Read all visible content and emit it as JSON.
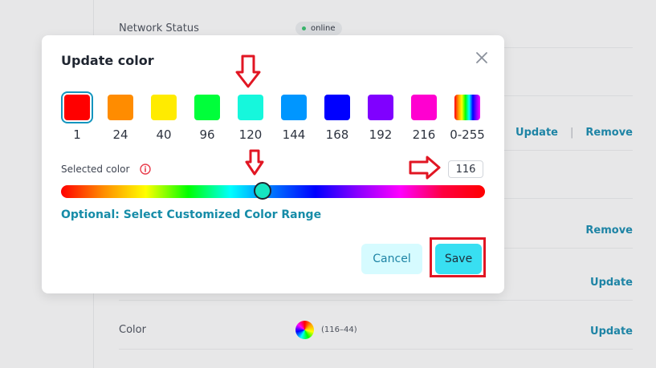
{
  "background": {
    "network_status_label": "Network Status",
    "network_status_value": "online",
    "update_label": "Update",
    "remove_label": "Remove",
    "separator": "|",
    "color_label": "Color",
    "color_range": "(116–44)"
  },
  "modal": {
    "title": "Update color",
    "swatches": [
      {
        "label": "1",
        "color": "#ff0000"
      },
      {
        "label": "24",
        "color": "#ff8c00"
      },
      {
        "label": "40",
        "color": "#ffeb00"
      },
      {
        "label": "96",
        "color": "#00ff3a"
      },
      {
        "label": "120",
        "color": "#16f7dc"
      },
      {
        "label": "144",
        "color": "#0096ff"
      },
      {
        "label": "168",
        "color": "#0000ff"
      },
      {
        "label": "192",
        "color": "#8000ff"
      },
      {
        "label": "216",
        "color": "#ff00d0"
      },
      {
        "label": "0-255",
        "color": "rainbow"
      }
    ],
    "selected_color_label": "Selected color",
    "selected_value": "116",
    "optional_link": "Optional: Select Customized Color Range",
    "cancel_label": "Cancel",
    "save_label": "Save"
  },
  "colors": {
    "accent": "#1e84a5",
    "selection_ring": "#1495be",
    "annotation": "#e11623"
  },
  "icons": {
    "close": "close-icon",
    "info": "info-icon",
    "annotation_arrow": "red-arrow-icon"
  }
}
